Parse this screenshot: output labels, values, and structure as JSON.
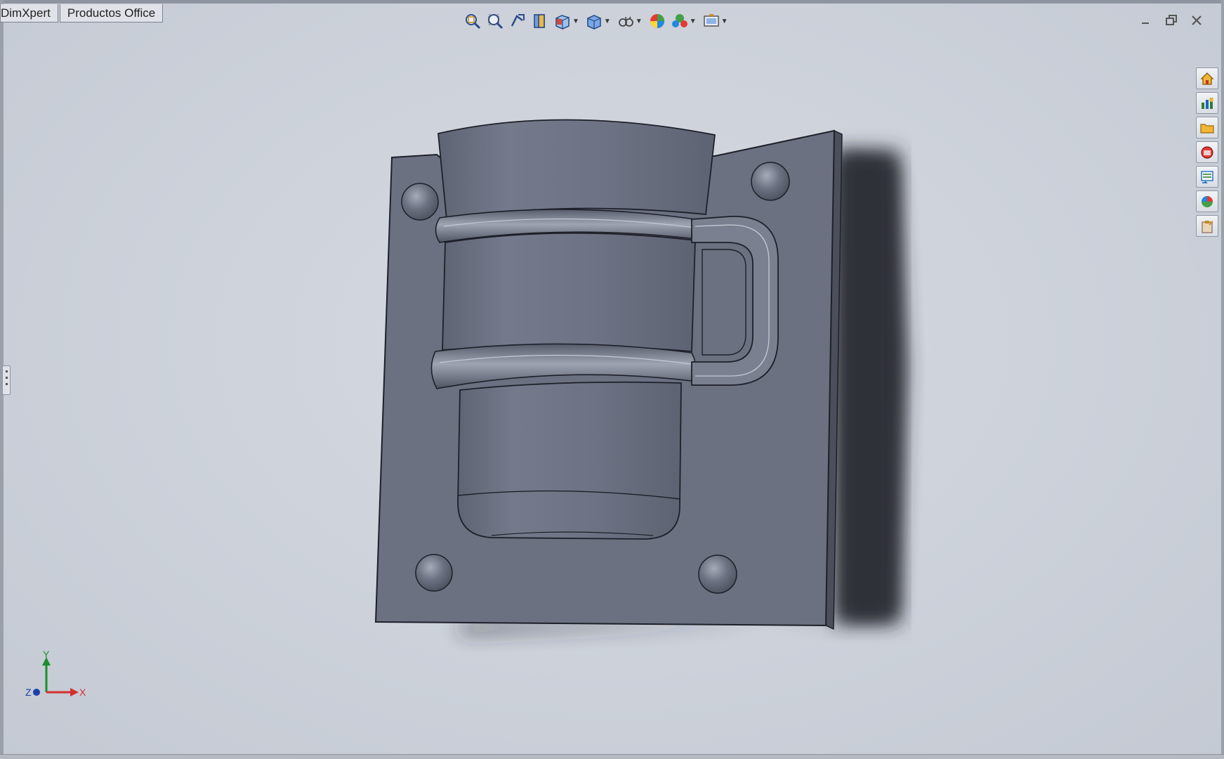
{
  "command_tabs": [
    {
      "label": "DimXpert"
    },
    {
      "label": "Productos Office"
    }
  ],
  "headsup_toolbar": [
    {
      "icon": "zoom-to-fit-icon",
      "dropdown": false
    },
    {
      "icon": "zoom-to-area-icon",
      "dropdown": false
    },
    {
      "icon": "previous-view-icon",
      "dropdown": false
    },
    {
      "icon": "section-view-icon",
      "dropdown": false
    },
    {
      "icon": "view-orientation-icon",
      "dropdown": true
    },
    {
      "icon": "display-style-icon",
      "dropdown": true
    },
    {
      "icon": "hide-show-items-icon",
      "dropdown": true
    },
    {
      "icon": "edit-appearance-icon",
      "dropdown": false
    },
    {
      "icon": "apply-scene-icon",
      "dropdown": true
    },
    {
      "icon": "view-settings-icon",
      "dropdown": true
    }
  ],
  "window_controls": [
    "minimize-icon",
    "restore-icon",
    "close-icon"
  ],
  "task_pane": [
    {
      "icon": "home-icon",
      "color": "#e8a317"
    },
    {
      "icon": "design-library-icon",
      "color": "#2e7d32"
    },
    {
      "icon": "file-explorer-icon",
      "color": "#f2b632"
    },
    {
      "icon": "view-palette-icon",
      "color": "#c62828"
    },
    {
      "icon": "custom-properties-icon",
      "color": "#1565c0"
    },
    {
      "icon": "appearances-icon",
      "color": "#2e7d32"
    },
    {
      "icon": "clipboard-icon",
      "color": "#8d6e63"
    }
  ],
  "triad": {
    "x_label": "X",
    "y_label": "Y",
    "z_label": "Z"
  },
  "colors": {
    "viewport_bg": "#cdd2db",
    "model_face": "#6b7181",
    "model_edge": "#1e2029",
    "shadow": "#2e3038"
  }
}
